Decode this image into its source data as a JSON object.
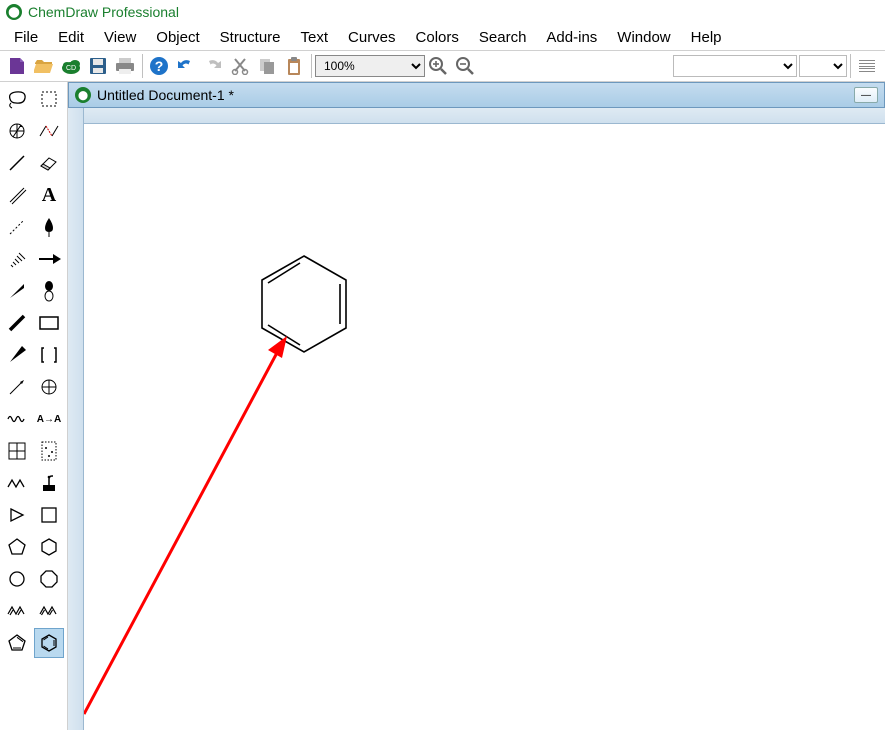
{
  "app": {
    "title": "ChemDraw Professional"
  },
  "menu": [
    "File",
    "Edit",
    "View",
    "Object",
    "Structure",
    "Text",
    "Curves",
    "Colors",
    "Search",
    "Add-ins",
    "Window",
    "Help"
  ],
  "toolbar": {
    "zoom_value": "100%"
  },
  "document": {
    "title": "Untitled Document-1 *"
  },
  "tool_icons": [
    "lasso",
    "marquee",
    "arrow-rotate",
    "structure-perspective",
    "bond-single",
    "eraser",
    "bond-multiple",
    "text-tool",
    "dashed-bond",
    "pen-tool",
    "hashed-bond",
    "arrow-curve",
    "wedge-bond",
    "reaction-arrow",
    "bold-bond",
    "bracket",
    "wavy-bond",
    "chemical-symbol",
    "squiggle-bond",
    "atom-label",
    "table-tool",
    "tlc-plate",
    "chain-tool",
    "stamp-tool",
    "play-triangle",
    "rectangle",
    "pentagon-tool",
    "hexagon-tool",
    "circle-tool",
    "octagon-tool",
    "cyclopentadiene",
    "cyclohexadiene",
    "cyclopentadiene-tool",
    "benzene-tool"
  ],
  "selected_tool": "benzene-tool",
  "annotation": {
    "color": "#ff0000"
  }
}
